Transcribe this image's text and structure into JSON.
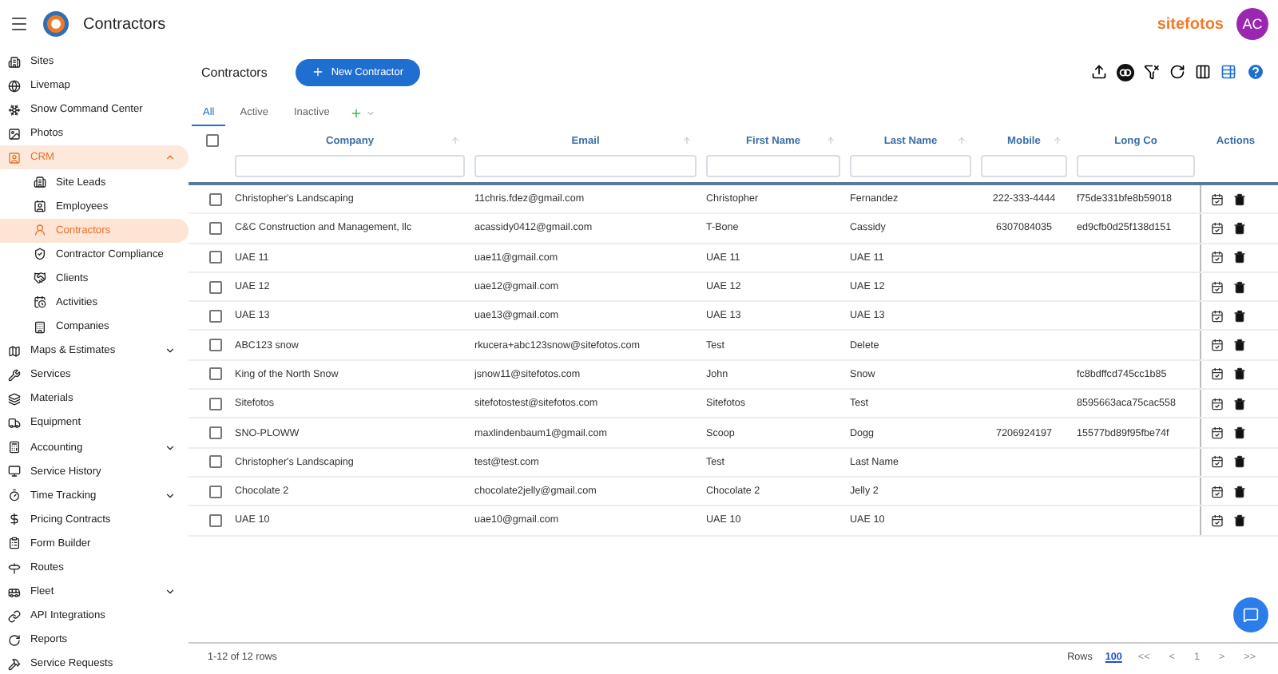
{
  "app_bar": {
    "title": "Contractors",
    "brand": "sitefotos",
    "avatar": "AC"
  },
  "sidebar": {
    "items": [
      {
        "label": "Sites",
        "selected": false
      },
      {
        "label": "Livemap",
        "selected": false
      },
      {
        "label": "Snow Command Center",
        "selected": false
      },
      {
        "label": "Photos",
        "selected": false
      },
      {
        "label": "CRM",
        "selected": true,
        "expanded": true,
        "children": [
          {
            "label": "Site Leads",
            "selected": false
          },
          {
            "label": "Employees",
            "selected": false
          },
          {
            "label": "Contractors",
            "selected": true
          },
          {
            "label": "Contractor Compliance",
            "selected": false
          },
          {
            "label": "Clients",
            "selected": false
          },
          {
            "label": "Activities",
            "selected": false
          },
          {
            "label": "Companies",
            "selected": false
          }
        ]
      },
      {
        "label": "Maps & Estimates",
        "selected": false,
        "expanded": false
      },
      {
        "label": "Services",
        "selected": false
      },
      {
        "label": "Materials",
        "selected": false
      },
      {
        "label": "Equipment",
        "selected": false
      },
      {
        "label": "Accounting",
        "selected": false,
        "expanded": false
      },
      {
        "label": "Service History",
        "selected": false
      },
      {
        "label": "Time Tracking",
        "selected": false,
        "expanded": false
      },
      {
        "label": "Pricing Contracts",
        "selected": false
      },
      {
        "label": "Form Builder",
        "selected": false
      },
      {
        "label": "Routes",
        "selected": false
      },
      {
        "label": "Fleet",
        "selected": false,
        "expanded": false
      },
      {
        "label": "API Integrations",
        "selected": false
      },
      {
        "label": "Reports",
        "selected": false
      },
      {
        "label": "Service Requests",
        "selected": false
      }
    ]
  },
  "page": {
    "title": "Contractors",
    "new_button": "New Contractor"
  },
  "tabs": [
    {
      "label": "All",
      "selected": true
    },
    {
      "label": "Active",
      "selected": false
    },
    {
      "label": "Inactive",
      "selected": false
    }
  ],
  "table": {
    "select_all": {
      "checked": false
    },
    "columns": [
      "Company",
      "Email",
      "First Name",
      "Last Name",
      "Mobile",
      "Long Co",
      "Actions"
    ],
    "rows": [
      {
        "checked": false,
        "cells": [
          "Christopher's Landscaping",
          "11chris.fdez@gmail.com",
          "Christopher",
          "Fernandez",
          "222-333-4444",
          "f75de331bfe8b59018"
        ]
      },
      {
        "checked": false,
        "cells": [
          "C&C Construction and Management, llc",
          "acassidy0412@gmail.com",
          "T-Bone",
          "Cassidy",
          "6307084035",
          "ed9cfb0d25f138d151"
        ]
      },
      {
        "checked": false,
        "cells": [
          "UAE 11",
          "uae11@gmail.com",
          "UAE 11",
          "UAE 11",
          "",
          ""
        ]
      },
      {
        "checked": false,
        "cells": [
          "UAE 12",
          "uae12@gmail.com",
          "UAE 12",
          "UAE 12",
          "",
          ""
        ]
      },
      {
        "checked": false,
        "cells": [
          "UAE 13",
          "uae13@gmail.com",
          "UAE 13",
          "UAE 13",
          "",
          ""
        ]
      },
      {
        "checked": false,
        "cells": [
          "ABC123 snow",
          "rkucera+abc123snow@sitefotos.com",
          "Test",
          "Delete",
          "",
          ""
        ]
      },
      {
        "checked": false,
        "cells": [
          "King of the North Snow",
          "jsnow11@sitefotos.com",
          "John",
          "Snow",
          "",
          "fc8bdffcd745cc1b85"
        ]
      },
      {
        "checked": false,
        "cells": [
          "Sitefotos",
          "sitefotostest@sitefotos.com",
          "Sitefotos",
          "Test",
          "",
          "8595663aca75cac558"
        ]
      },
      {
        "checked": false,
        "cells": [
          "SNO-PLOWW",
          "maxlindenbaum1@gmail.com",
          "Scoop",
          "Dogg",
          "7206924197",
          "15577bd89f95fbe74f"
        ]
      },
      {
        "checked": false,
        "cells": [
          "Christopher's Landscaping",
          "test@test.com",
          "Test",
          "Last Name",
          "",
          ""
        ]
      },
      {
        "checked": false,
        "cells": [
          "Chocolate 2",
          "chocolate2jelly@gmail.com",
          "Chocolate 2",
          "Jelly 2",
          "",
          ""
        ]
      },
      {
        "checked": false,
        "cells": [
          "UAE 10",
          "uae10@gmail.com",
          "UAE 10",
          "UAE 10",
          "",
          ""
        ]
      }
    ]
  },
  "footer": {
    "summary": "1-12 of 12 rows",
    "rows_label": "Rows",
    "rows_value": "100",
    "pager": [
      "<<",
      "<",
      "1",
      ">",
      ">>"
    ]
  }
}
